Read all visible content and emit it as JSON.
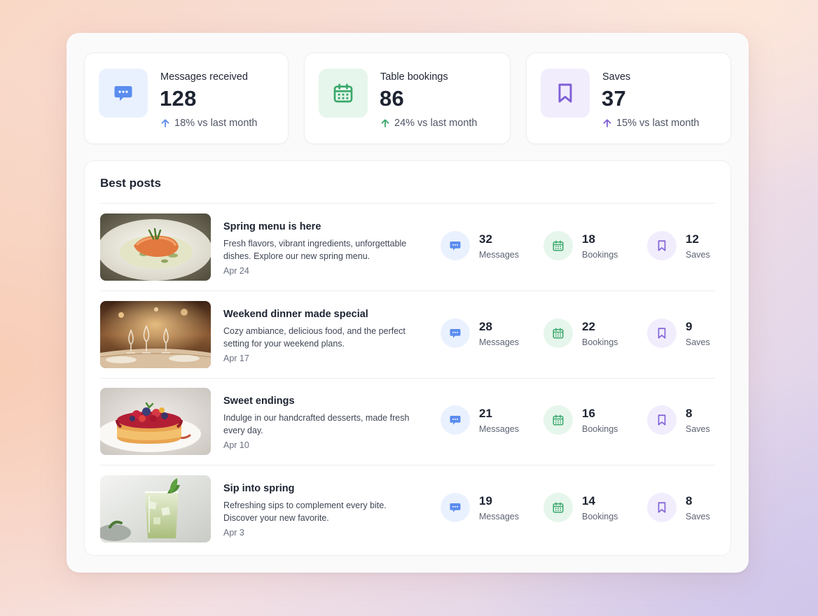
{
  "stats": [
    {
      "label": "Messages received",
      "value": "128",
      "trend": "18% vs last month",
      "icon": "chat-icon",
      "color": "#5b8def"
    },
    {
      "label": "Table bookings",
      "value": "86",
      "trend": "24% vs last month",
      "icon": "calendar-icon",
      "color": "#3aa86a"
    },
    {
      "label": "Saves",
      "value": "37",
      "trend": "15% vs last month",
      "icon": "bookmark-icon",
      "color": "#8060d6"
    }
  ],
  "best_posts": {
    "title": "Best posts",
    "posts": [
      {
        "title": "Spring menu is here",
        "description": "Fresh flavors, vibrant ingredients, unforgettable dishes. Explore our new spring menu.",
        "date": "Apr 24",
        "messages": "32",
        "bookings": "18",
        "saves": "12",
        "image": "salmon-dish-photo"
      },
      {
        "title": "Weekend dinner made special",
        "description": "Cozy ambiance, delicious food, and the perfect setting for your weekend plans.",
        "date": "Apr 17",
        "messages": "28",
        "bookings": "22",
        "saves": "9",
        "image": "restaurant-table-photo"
      },
      {
        "title": "Sweet endings",
        "description": "Indulge in our handcrafted desserts, made fresh every day.",
        "date": "Apr 10",
        "messages": "21",
        "bookings": "16",
        "saves": "8",
        "image": "berry-tart-photo"
      },
      {
        "title": "Sip into spring",
        "description": "Refreshing sips to complement every bite. Discover your new favorite.",
        "date": "Apr 3",
        "messages": "19",
        "bookings": "14",
        "saves": "8",
        "image": "green-cocktail-photo"
      }
    ],
    "metric_labels": {
      "messages": "Messages",
      "bookings": "Bookings",
      "saves": "Saves"
    }
  }
}
